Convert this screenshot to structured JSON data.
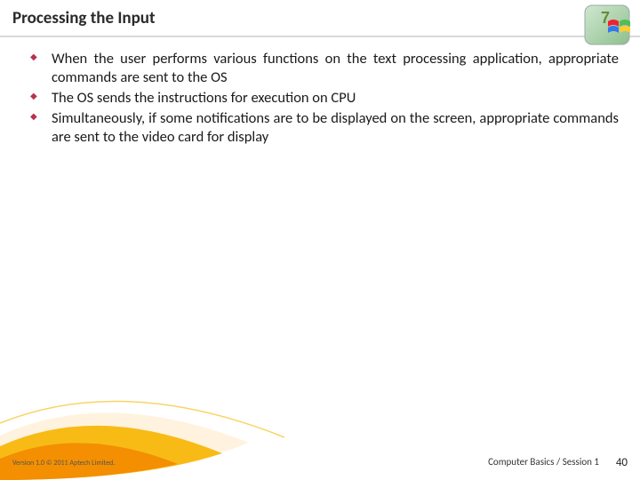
{
  "slide": {
    "title": "Processing the Input",
    "bullets": [
      "When the user performs various functions on the text processing application, appropriate commands are sent to the OS",
      "The OS sends the instructions for execution on CPU",
      "Simultaneously, if some notifications are to be displayed on the screen, appropriate commands are sent to the video card for display"
    ]
  },
  "footer": {
    "left": "Version 1.0 © 2011 Aptech Limited.",
    "right": "Computer Basics / Session 1",
    "page": "40"
  },
  "colors": {
    "bullet": "#b8324a",
    "swoosh_primary": "#f7b500",
    "swoosh_secondary": "#f28c00",
    "swoosh_light": "#fff3e0"
  }
}
